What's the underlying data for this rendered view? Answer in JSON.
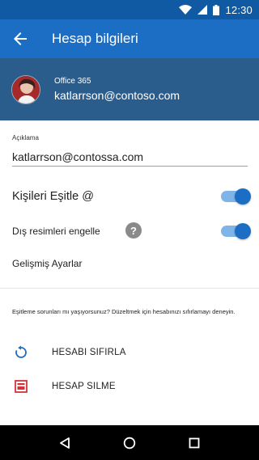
{
  "status_bar": {
    "time": "12:30",
    "icons": [
      "wifi-icon",
      "signal-icon",
      "battery-icon"
    ]
  },
  "app_bar": {
    "title": "Hesap bilgileri",
    "back_icon": "arrow-left-icon"
  },
  "account": {
    "type": "Office 365",
    "email": "katlarrson@contoso.com"
  },
  "description": {
    "label": "Açıklama",
    "value": "katlarrson@contossa.com"
  },
  "settings": {
    "sync_contacts": {
      "label": "Kişileri Eşitle @",
      "enabled": true
    },
    "block_external_images": {
      "label": "Dış resimleri engelle",
      "enabled": true,
      "help_icon": "question-circle-icon"
    }
  },
  "advanced_settings_label": "Gelişmiş Ayarlar",
  "sync_help_text": "Eşitleme sorunları mı yaşıyorsunuz? Düzeltmek için hesabınızı sıfırlamayı deneyin.",
  "actions": {
    "reset": {
      "label": "HESABI SIFIRLA",
      "icon": "reset-icon"
    },
    "delete": {
      "label": "HESAP SILME",
      "icon": "delete-account-icon"
    }
  },
  "nav_bar": {
    "buttons": [
      "back-triangle-icon",
      "home-circle-icon",
      "recents-square-icon"
    ]
  },
  "colors": {
    "status_bar": "#0f5aa3",
    "app_bar": "#1c6ec4",
    "account_header": "#2a5c8c",
    "toggle_on": "#1c6ec4",
    "reset_icon": "#1c6ec4",
    "delete_icon": "#d13438"
  }
}
